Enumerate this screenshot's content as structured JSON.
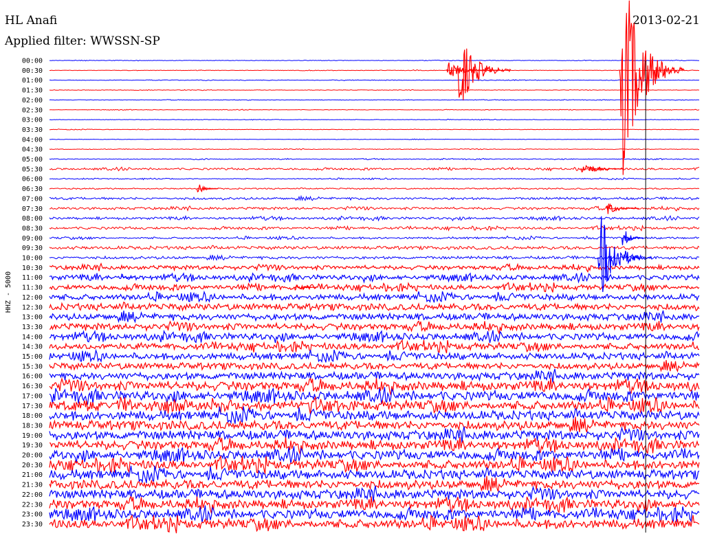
{
  "header": {
    "station": "HL Anafi",
    "date": "2013-02-21",
    "filter_label": "Applied filter: WWSSN-SP"
  },
  "colors": {
    "even_trace": "#0000ff",
    "odd_trace": "#ff0000",
    "line": "#000000"
  },
  "chart_data": {
    "type": "line",
    "ylabel": "HHZ - 5000",
    "row_interval_minutes": 30,
    "categories": [
      "00:00",
      "00:30",
      "01:00",
      "01:30",
      "02:00",
      "02:30",
      "03:00",
      "03:30",
      "04:00",
      "04:30",
      "05:00",
      "05:30",
      "06:00",
      "06:30",
      "07:00",
      "07:30",
      "08:00",
      "08:30",
      "09:00",
      "09:30",
      "10:00",
      "10:30",
      "11:00",
      "11:30",
      "12:00",
      "12:30",
      "13:00",
      "13:30",
      "14:00",
      "14:30",
      "15:00",
      "15:30",
      "16:00",
      "16:30",
      "17:00",
      "17:30",
      "18:00",
      "18:30",
      "19:00",
      "19:30",
      "20:00",
      "20:30",
      "21:00",
      "21:30",
      "22:00",
      "22:30",
      "23:00",
      "23:30"
    ],
    "noise_level": [
      0.3,
      0.3,
      0.3,
      0.3,
      0.3,
      0.3,
      0.3,
      0.3,
      0.3,
      0.4,
      0.5,
      1.2,
      0.6,
      0.8,
      1.5,
      1.5,
      1.5,
      1.5,
      1.2,
      2,
      1.8,
      2.5,
      3,
      3,
      3.5,
      4,
      4,
      4,
      4,
      4,
      4,
      4,
      4.5,
      5.5,
      5.5,
      5.5,
      5.5,
      5.5,
      5.5,
      5.5,
      5.5,
      5.5,
      5.5,
      5.5,
      5.5,
      5.5,
      5.5,
      5.5
    ],
    "events": [
      {
        "row": 1,
        "minute": 18.8,
        "amplitude": 70,
        "duration_min": 2.5
      },
      {
        "row": 1,
        "minute": 26.3,
        "amplitude": 190,
        "duration_min": 3
      },
      {
        "row": 1,
        "minute": 18.3,
        "amplitude": 14,
        "duration_min": 2.5
      },
      {
        "row": 11,
        "minute": 24.5,
        "amplitude": 12,
        "duration_min": 2
      },
      {
        "row": 13,
        "minute": 6.8,
        "amplitude": 10,
        "duration_min": 1
      },
      {
        "row": 15,
        "minute": 25.7,
        "amplitude": 12,
        "duration_min": 1.5
      },
      {
        "row": 18,
        "minute": 26.4,
        "amplitude": 22,
        "duration_min": 1
      },
      {
        "row": 20,
        "minute": 25.3,
        "amplitude": 80,
        "duration_min": 2.5
      },
      {
        "row": 22,
        "minute": 3.3,
        "amplitude": 10,
        "duration_min": 0.5
      },
      {
        "row": 23,
        "minute": 11.3,
        "amplitude": 10,
        "duration_min": 1
      }
    ]
  }
}
